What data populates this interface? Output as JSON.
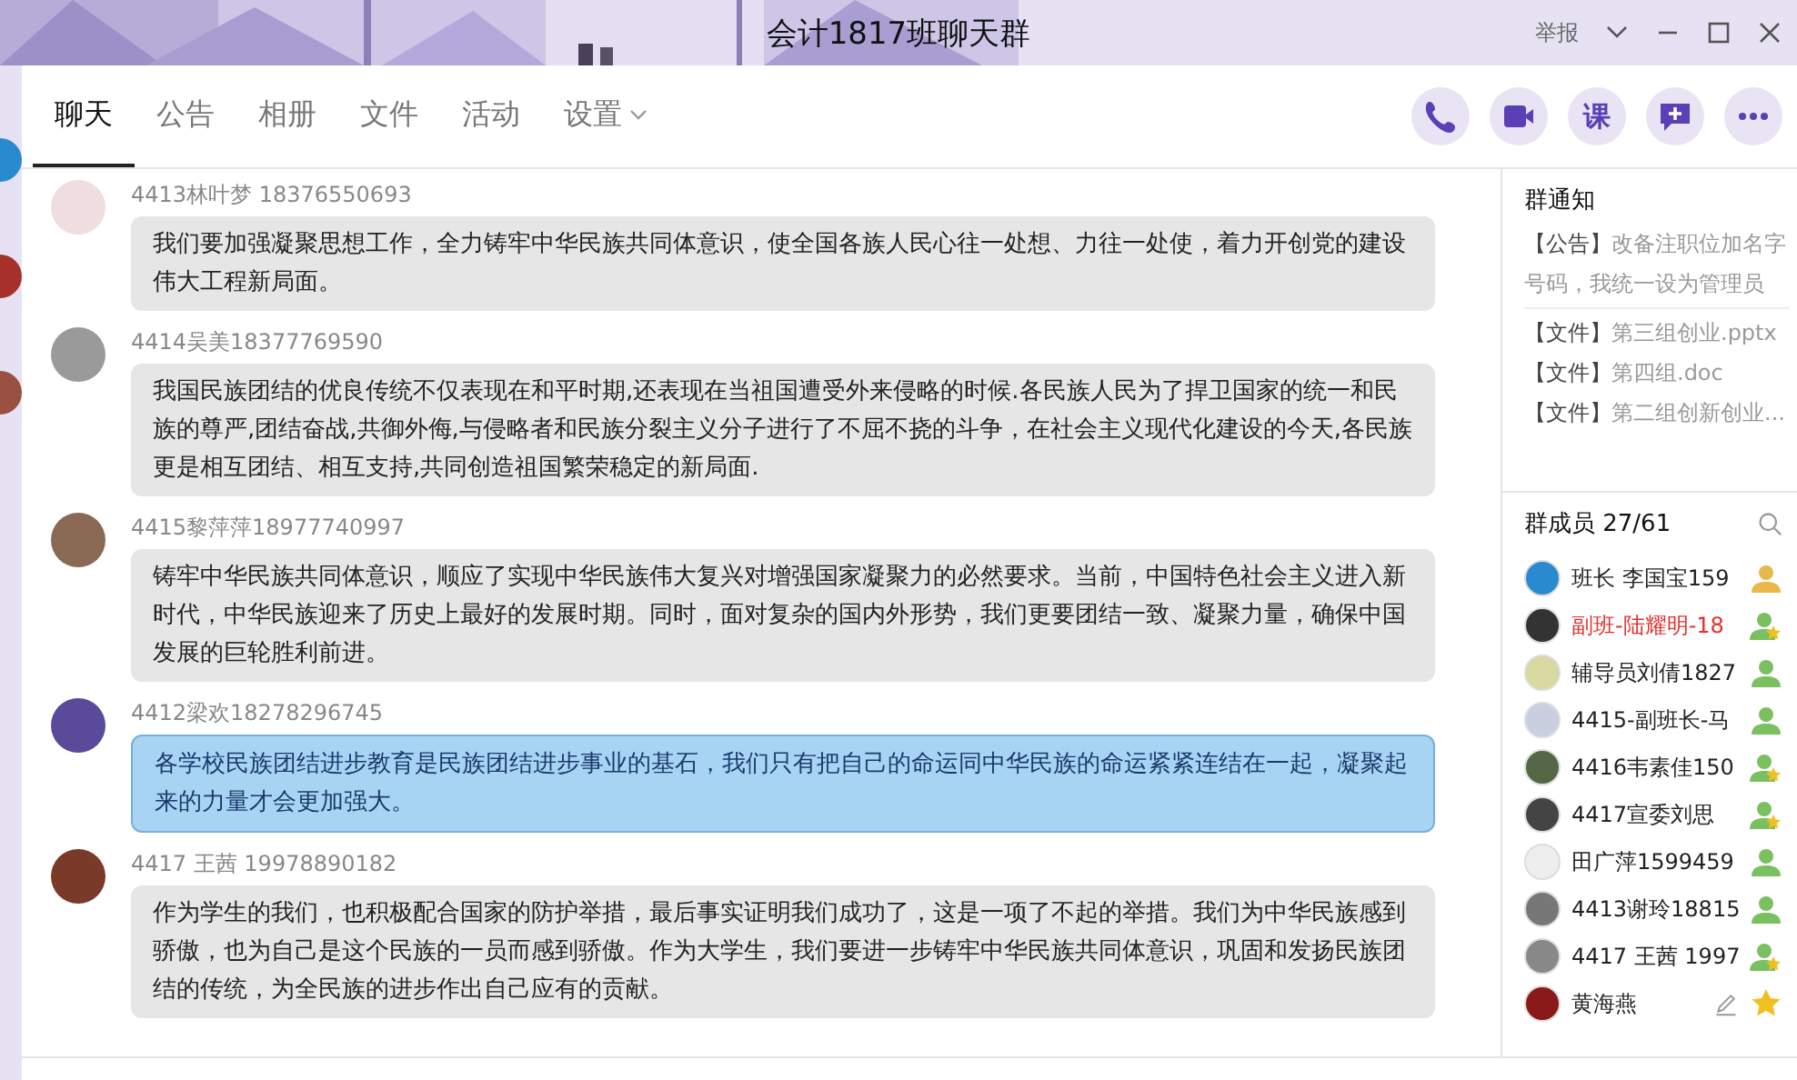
{
  "window": {
    "title": "会计1817班聊天群",
    "report": "举报"
  },
  "tabs": [
    {
      "label": "聊天",
      "selected": true,
      "dropdown": false
    },
    {
      "label": "公告",
      "selected": false,
      "dropdown": false
    },
    {
      "label": "相册",
      "selected": false,
      "dropdown": false
    },
    {
      "label": "文件",
      "selected": false,
      "dropdown": false
    },
    {
      "label": "活动",
      "selected": false,
      "dropdown": false
    },
    {
      "label": "设置",
      "selected": false,
      "dropdown": true
    }
  ],
  "toolbar": [
    {
      "kind": "phone"
    },
    {
      "kind": "video"
    },
    {
      "kind": "text",
      "label": "课"
    },
    {
      "kind": "add-message"
    },
    {
      "kind": "more"
    }
  ],
  "messages": [
    {
      "sender": "4413林叶梦 18376550693",
      "text": "我们要加强凝聚思想工作，全力铸牢中华民族共同体意识，使全国各族人民心往一处想、力往一处使，着力开创党的建设伟大工程新局面。",
      "mine": false
    },
    {
      "sender": "4414吴美18377769590",
      "text": "我国民族团结的优良传统不仅表现在和平时期,还表现在当祖国遭受外来侵略的时候.各民族人民为了捍卫国家的统一和民族的尊严,团结奋战,共御外侮,与侵略者和民族分裂主义分子进行了不屈不挠的斗争，在社会主义现代化建设的今天,各民族更是相互团结、相互支持,共同创造祖国繁荣稳定的新局面.",
      "mine": false
    },
    {
      "sender": "4415黎萍萍18977740997",
      "text": "铸牢中华民族共同体意识，顺应了实现中华民族伟大复兴对增强国家凝聚力的必然要求。当前，中国特色社会主义进入新时代，中华民族迎来了历史上最好的发展时期。同时，面对复杂的国内外形势，我们更要团结一致、凝聚力量，确保中国发展的巨轮胜利前进。",
      "mine": false
    },
    {
      "sender": "4412梁欢18278296745",
      "text": "各学校民族团结进步教育是民族团结进步事业的基石，我们只有把自己的命运同中华民族的命运紧紧连结在一起，凝聚起来的力量才会更加强大。",
      "mine": true
    },
    {
      "sender": "4417 王茜 19978890182",
      "text": "作为学生的我们，也积极配合国家的防护举措，最后事实证明我们成功了，这是一项了不起的举措。我们为中华民族感到骄傲，也为自己是这个民族的一员而感到骄傲。作为大学生，我们要进一步铸牢中华民族共同体意识，巩固和发扬民族团结的传统，为全民族的进步作出自己应有的贡献。",
      "mine": false
    }
  ],
  "notice": {
    "title": "群通知",
    "items": [
      {
        "tag": "【公告】",
        "text": "改备注职位加名字号码，我统一设为管理员"
      },
      {
        "tag": "【文件】",
        "text": "第三组创业.pptx"
      },
      {
        "tag": "【文件】",
        "text": "第四组.doc"
      },
      {
        "tag": "【文件】",
        "text": "第二组创新创业..."
      }
    ]
  },
  "members": {
    "title": "群成员 27/61",
    "items": [
      {
        "name": "班长 李国宝159",
        "kind": "owner",
        "highlight": false
      },
      {
        "name": "副班-陆耀明-18",
        "kind": "admin",
        "highlight": true
      },
      {
        "name": "辅导员刘倩1827",
        "kind": "member",
        "highlight": false
      },
      {
        "name": "4415-副班长-马",
        "kind": "member",
        "highlight": false
      },
      {
        "name": "4416韦素佳150",
        "kind": "admin",
        "highlight": false
      },
      {
        "name": "4417宣委刘思",
        "kind": "admin",
        "highlight": false
      },
      {
        "name": "田广萍1599459",
        "kind": "member",
        "highlight": false
      },
      {
        "name": "4413谢玲18815",
        "kind": "member",
        "highlight": false
      },
      {
        "name": "4417 王茜 1997",
        "kind": "admin",
        "highlight": false
      },
      {
        "name": "黄海燕",
        "kind": "editor",
        "highlight": false
      }
    ]
  }
}
